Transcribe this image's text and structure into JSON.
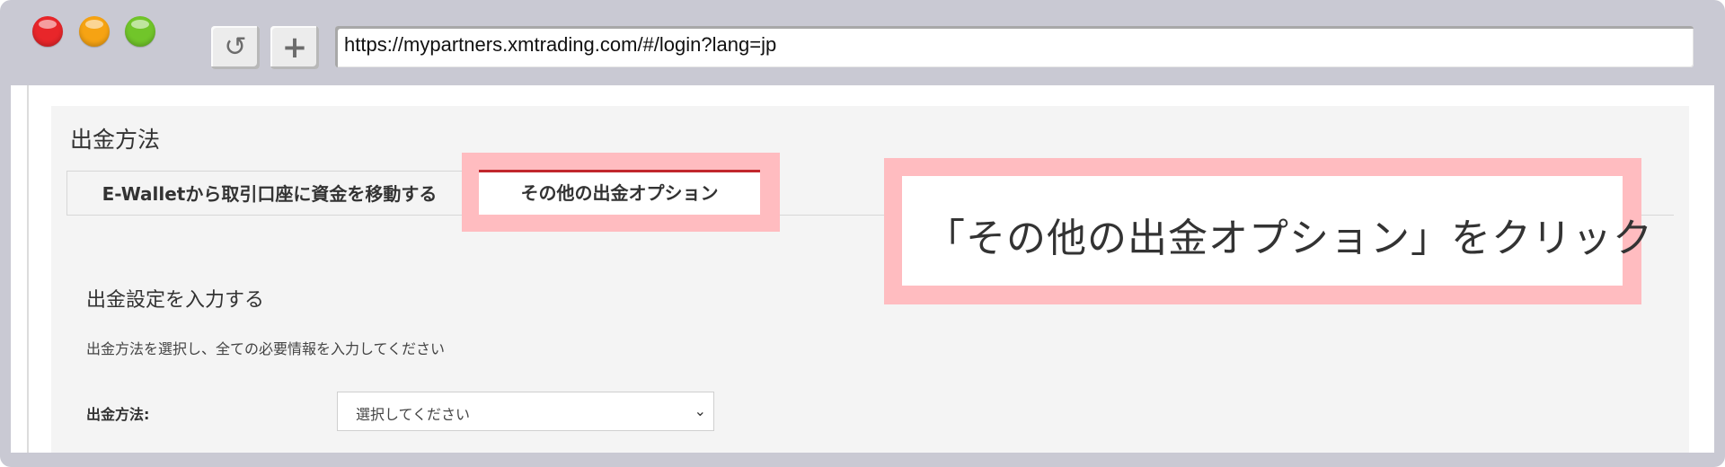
{
  "browser": {
    "url": "https://mypartners.xmtrading.com/#/login?lang=jp",
    "reload_glyph": "↺",
    "newtab_glyph": "+"
  },
  "page": {
    "title": "出金方法",
    "tabs": [
      {
        "label": "E-Walletから取引口座に資金を移動する",
        "active": false
      },
      {
        "label": "その他の出金オプション",
        "active": true
      }
    ],
    "section_title": "出金設定を入力する",
    "section_desc": "出金方法を選択し、全ての必要情報を入力してください",
    "field_label": "出金方法:",
    "select_value": "選択してください",
    "select_chevron": "⌄"
  },
  "annotation": {
    "text": "「その他の出金オプション」をクリック",
    "highlight_color": "#ffbcc0"
  },
  "colors": {
    "active_tab_border": "#c1272d",
    "chrome": "#c9c9d3"
  }
}
